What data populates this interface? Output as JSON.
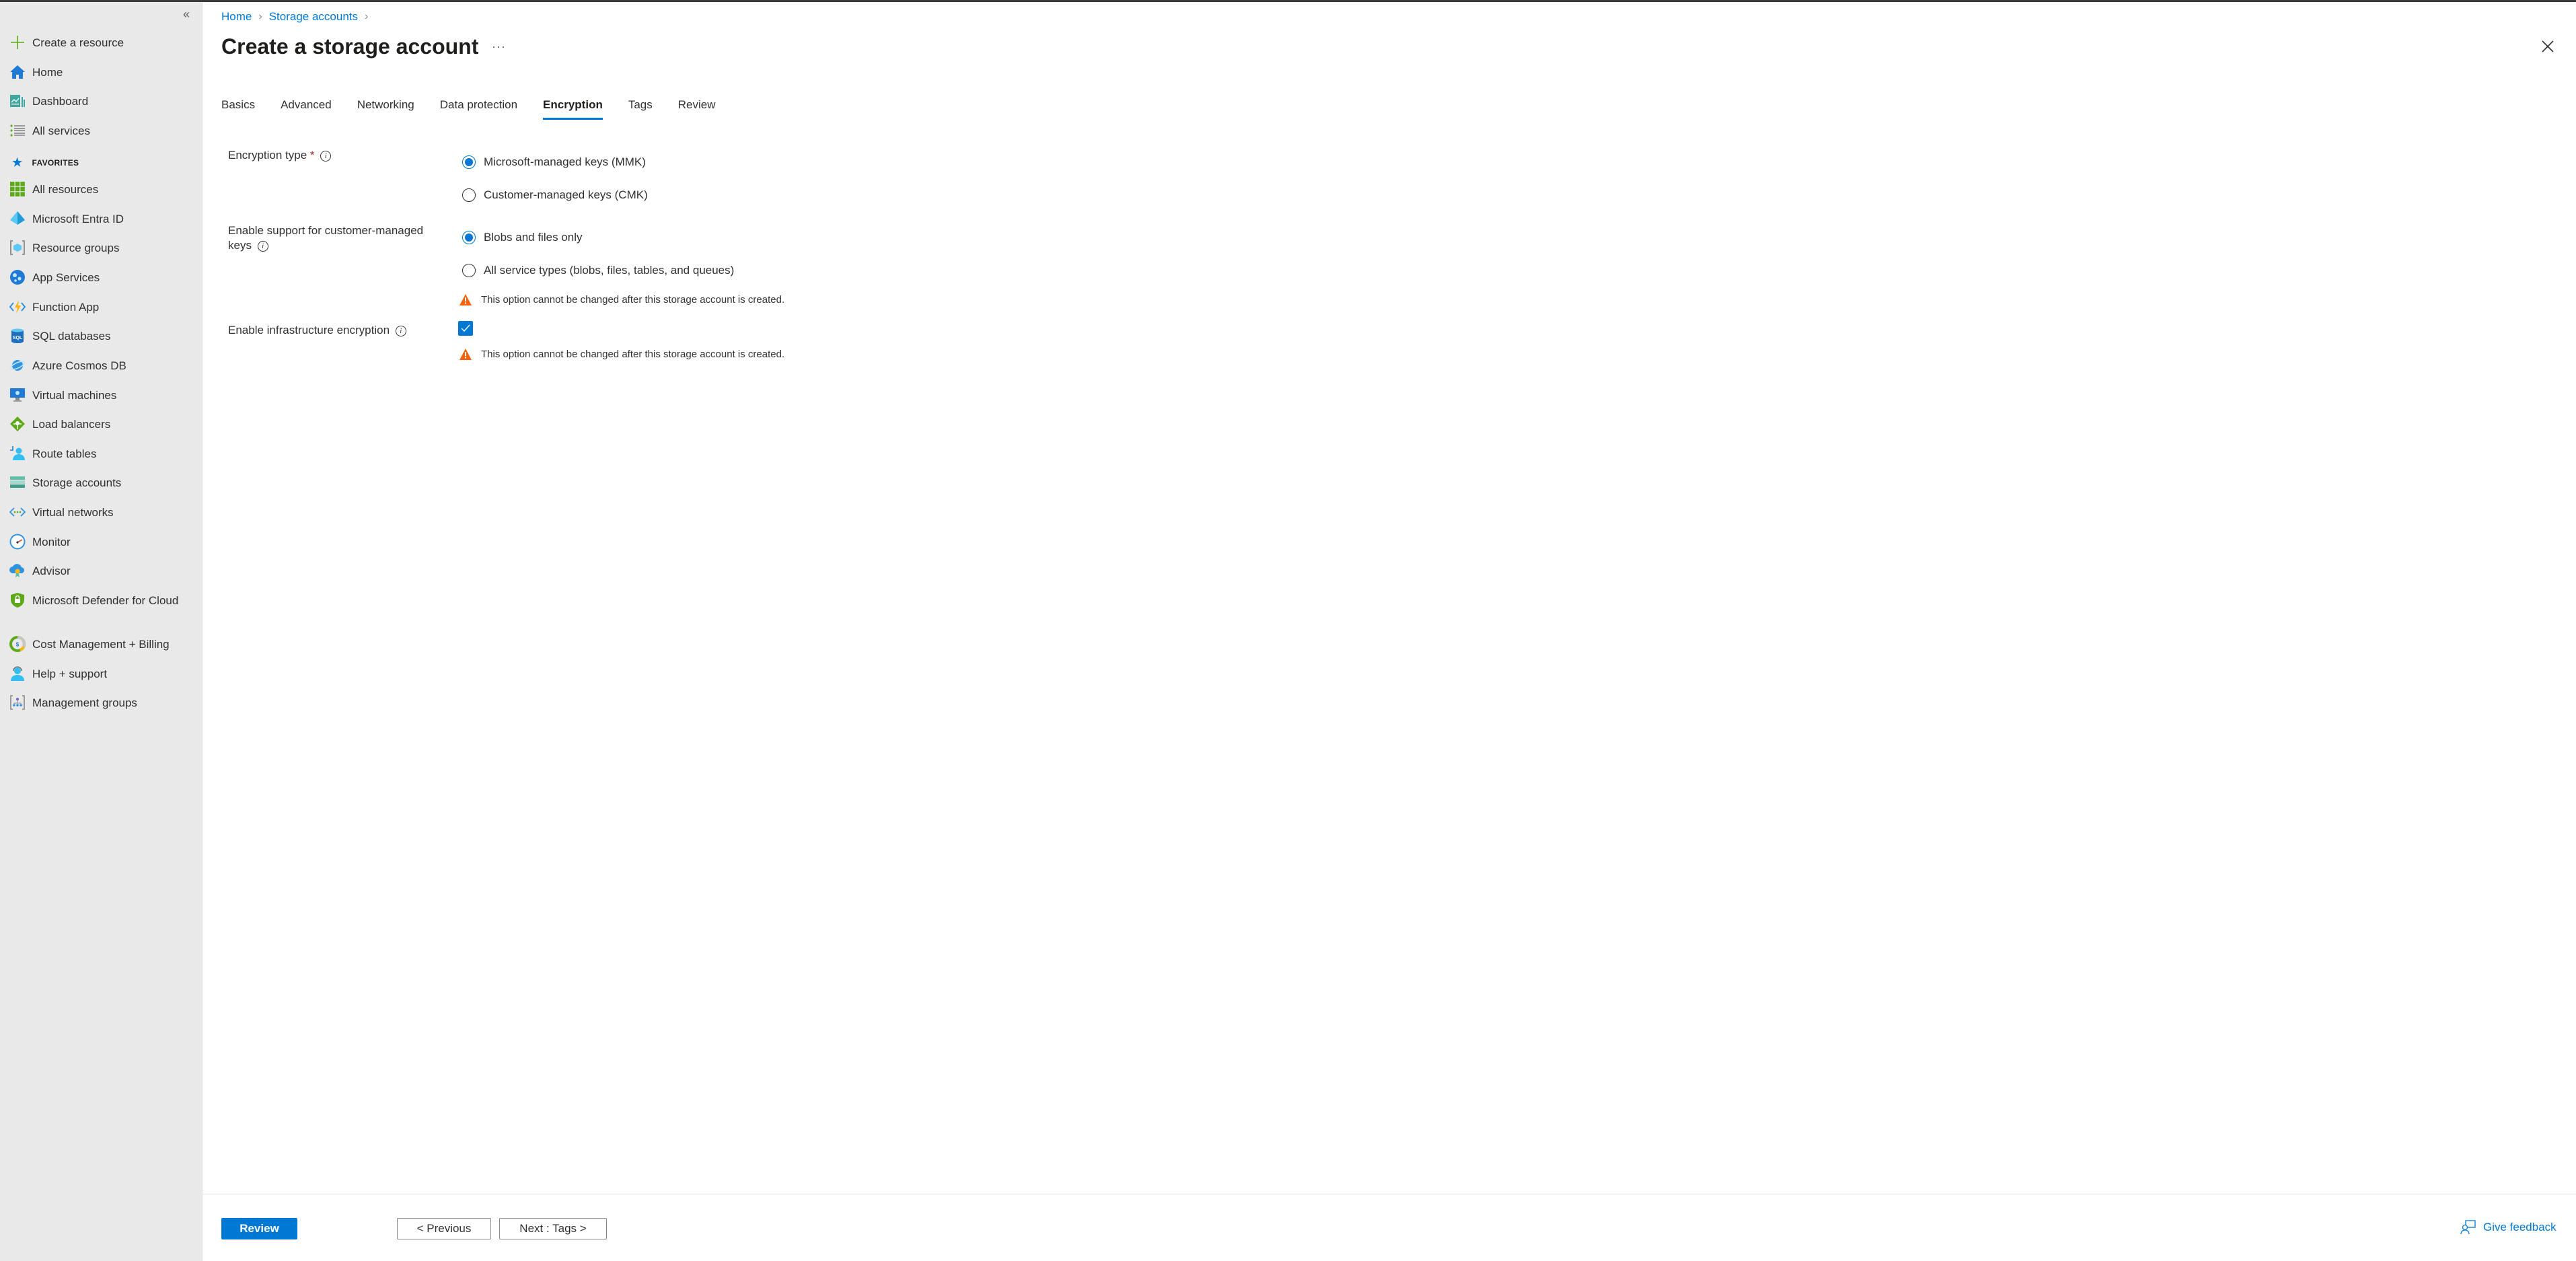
{
  "sidebar": {
    "collapse_label": "«",
    "items": [
      {
        "label": "Create a resource",
        "icon": "plus-icon"
      },
      {
        "label": "Home",
        "icon": "home-icon"
      },
      {
        "label": "Dashboard",
        "icon": "dashboard-icon"
      },
      {
        "label": "All services",
        "icon": "list-icon"
      }
    ],
    "favorites_heading": "FAVORITES",
    "favorites": [
      {
        "label": "All resources",
        "icon": "grid-icon"
      },
      {
        "label": "Microsoft Entra ID",
        "icon": "entra-icon"
      },
      {
        "label": "Resource groups",
        "icon": "resource-group-icon"
      },
      {
        "label": "App Services",
        "icon": "app-services-icon"
      },
      {
        "label": "Function App",
        "icon": "function-app-icon"
      },
      {
        "label": "SQL databases",
        "icon": "sql-icon"
      },
      {
        "label": "Azure Cosmos DB",
        "icon": "cosmos-icon"
      },
      {
        "label": "Virtual machines",
        "icon": "vm-icon"
      },
      {
        "label": "Load balancers",
        "icon": "load-balancer-icon"
      },
      {
        "label": "Route tables",
        "icon": "route-table-icon"
      },
      {
        "label": "Storage accounts",
        "icon": "storage-icon"
      },
      {
        "label": "Virtual networks",
        "icon": "vnet-icon"
      },
      {
        "label": "Monitor",
        "icon": "monitor-icon"
      },
      {
        "label": "Advisor",
        "icon": "advisor-icon"
      },
      {
        "label": "Microsoft Defender for Cloud",
        "icon": "defender-icon"
      },
      {
        "label": "Cost Management + Billing",
        "icon": "cost-icon"
      },
      {
        "label": "Help + support",
        "icon": "help-icon"
      },
      {
        "label": "Management groups",
        "icon": "management-groups-icon"
      }
    ]
  },
  "header": {
    "breadcrumb": [
      "Home",
      "Storage accounts"
    ],
    "title": "Create a storage account",
    "more_label": "···"
  },
  "tabs": [
    {
      "label": "Basics",
      "active": false
    },
    {
      "label": "Advanced",
      "active": false
    },
    {
      "label": "Networking",
      "active": false
    },
    {
      "label": "Data protection",
      "active": false
    },
    {
      "label": "Encryption",
      "active": true
    },
    {
      "label": "Tags",
      "active": false
    },
    {
      "label": "Review",
      "active": false
    }
  ],
  "form": {
    "encryption_type": {
      "label": "Encryption type",
      "required_mark": "*",
      "options": [
        "Microsoft-managed keys (MMK)",
        "Customer-managed keys (CMK)"
      ],
      "selected": "Microsoft-managed keys (MMK)"
    },
    "cmk_support": {
      "label": "Enable support for customer-managed keys",
      "options": [
        "Blobs and files only",
        "All service types (blobs, files, tables, and queues)"
      ],
      "selected": "Blobs and files only",
      "warning": "This option cannot be changed after this storage account is created."
    },
    "infrastructure_encryption": {
      "label": "Enable infrastructure encryption",
      "checked": true,
      "warning": "This option cannot be changed after this storage account is created."
    },
    "info_glyph": "i"
  },
  "footer": {
    "review_label": "Review",
    "previous_label": "< Previous",
    "next_label": "Next : Tags >",
    "feedback_label": "Give feedback"
  },
  "colors": {
    "accent": "#0078d4",
    "warning": "#f7630c",
    "required": "#a4262c"
  }
}
